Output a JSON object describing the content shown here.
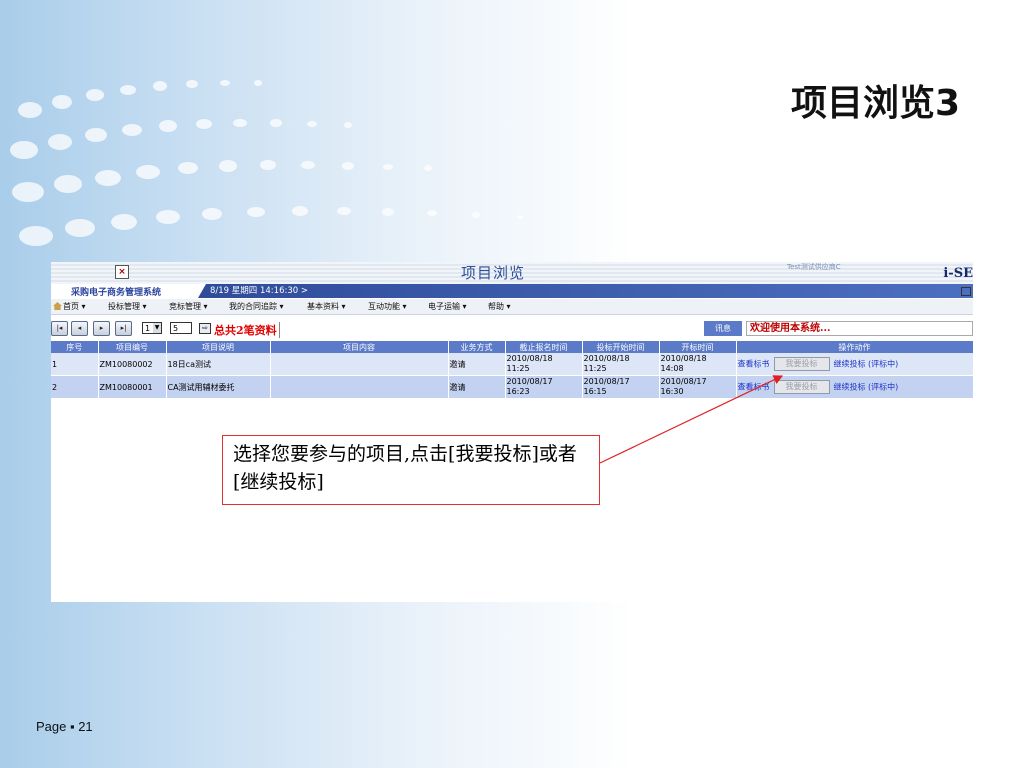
{
  "slide": {
    "title": "项目浏览3",
    "page_label": "Page ▪ 21"
  },
  "app": {
    "header_title": "项目浏览",
    "supplier_label": "Test测试供应商C",
    "logo": "i-SE",
    "system_name": "采购电子商务管理系统",
    "datetime": "8/19 星期四  14:16:30 >"
  },
  "menu": {
    "items": [
      "首页",
      "投标管理",
      "竞标管理",
      "我的合同追踪",
      "基本资料",
      "互动功能",
      "电子运输",
      "帮助"
    ]
  },
  "pager": {
    "page": "1",
    "page_size": "5",
    "total_text": "总共2笔资料",
    "buttons": [
      "first-page-icon",
      "prev-page-icon",
      "next-page-icon",
      "last-page-icon"
    ]
  },
  "notice": {
    "label": "讯息",
    "message": "欢迎使用本系统..."
  },
  "table": {
    "headers": [
      "序号",
      "项目编号",
      "项目说明",
      "项目内容",
      "业务方式",
      "截止报名时间",
      "投标开始时间",
      "开标时间",
      "操作动作"
    ],
    "rows": [
      {
        "no": "1",
        "code": "ZM10080002",
        "desc": "18日ca测试",
        "content": "",
        "mode": "邀请",
        "deadline_date": "2010/08/18",
        "deadline_time": "11:25",
        "bid_start_date": "2010/08/18",
        "bid_start_time": "11:25",
        "open_date": "2010/08/18",
        "open_time": "14:08",
        "view_label": "查看标书",
        "bid_label": "我要投标",
        "continue_label": "继续投标 (评标中)"
      },
      {
        "no": "2",
        "code": "ZM10080001",
        "desc": "CA测试用辅材委托",
        "content": "",
        "mode": "邀请",
        "deadline_date": "2010/08/17",
        "deadline_time": "16:23",
        "bid_start_date": "2010/08/17",
        "bid_start_time": "16:15",
        "open_date": "2010/08/17",
        "open_time": "16:30",
        "view_label": "查看标书",
        "bid_label": "我要投标",
        "continue_label": "继续投标 (评标中)"
      }
    ]
  },
  "callout": {
    "text": "选择您要参与的项目,点击[我要投标]或者[继续投标]"
  },
  "colors": {
    "header_blue": "#5b7ac8",
    "row_light": "#dde6f7",
    "row_dark": "#c3d2f1",
    "link": "#1a30c8",
    "alert_red": "#e00000"
  }
}
